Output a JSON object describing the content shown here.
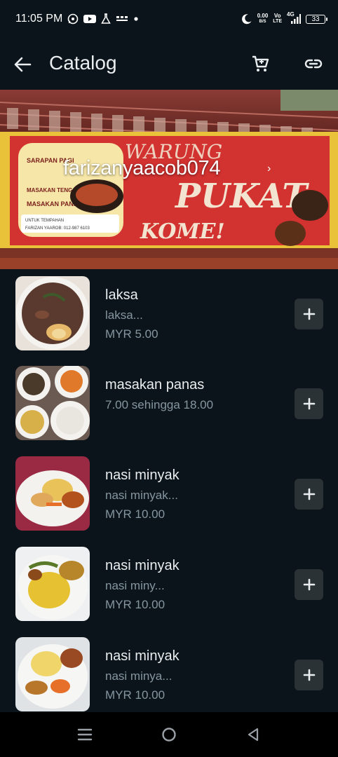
{
  "status_bar": {
    "time": "11:05 PM",
    "net_speed_value": "0.00",
    "net_speed_unit": "B/S",
    "volte_top": "Vo",
    "volte_bottom": "LTE",
    "network": "4G",
    "battery": "33",
    "icons": [
      "whatsapp-icon",
      "youtube-icon",
      "flask-icon",
      "roaming-icon",
      "dot-icon",
      "moon-icon",
      "signal-icon"
    ]
  },
  "app_bar": {
    "title": "Catalog",
    "icons": [
      "back-arrow-icon",
      "cart-icon",
      "link-icon"
    ]
  },
  "cover": {
    "business_name": "farizanyaacob074",
    "chevron": "›",
    "banner_text": {
      "line1": "WARUNG",
      "line2": "PUKAT",
      "line3": "KOME!",
      "menu_1": "SARAPAN PAGI",
      "menu_2": "MASAKAN TENGAH HARI",
      "menu_3": "MASAKAN PANAS",
      "contact_label": "UNTUK TEMPAHAN",
      "contact": "FARIZAN YAAROB: 012-987 6103"
    }
  },
  "items": [
    {
      "name": "laksa",
      "description": "laksa...",
      "price": "MYR 5.00"
    },
    {
      "name": "masakan panas",
      "description": "7.00 sehingga 18.00",
      "price": ""
    },
    {
      "name": "nasi minyak",
      "description": "nasi minyak...",
      "price": "MYR 10.00"
    },
    {
      "name": "nasi minyak",
      "description": "nasi miny...",
      "price": "MYR 10.00"
    },
    {
      "name": "nasi minyak",
      "description": "nasi minya...",
      "price": "MYR 10.00"
    }
  ],
  "nav_bar": {
    "icons": [
      "menu-icon",
      "home-icon",
      "back-triangle-icon"
    ]
  },
  "colors": {
    "background": "#0b141a",
    "text_primary": "#e9edef",
    "text_secondary": "#8696a0",
    "button_bg": "#2a3235"
  }
}
